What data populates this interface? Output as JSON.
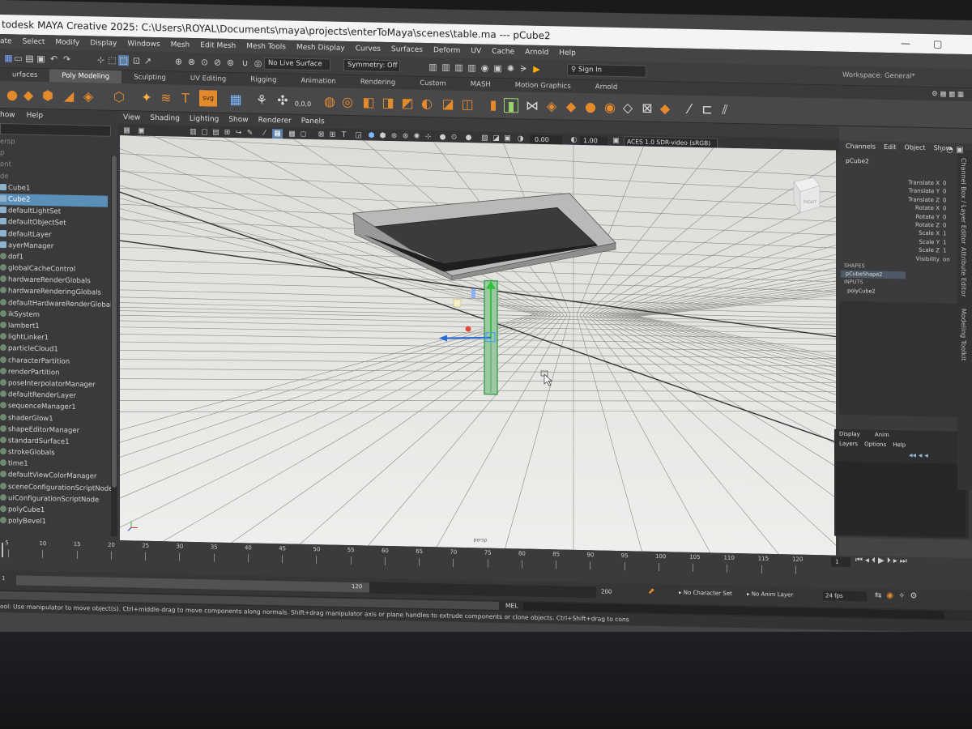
{
  "window": {
    "title": "todesk MAYA Creative 2025: C:\\Users\\ROYAL\\Documents\\maya\\projects\\enterToMaya\\scenes\\table.ma   ---   pCube2",
    "minimize": "—",
    "maximize": "▢"
  },
  "menubar": [
    "ate",
    "Select",
    "Modify",
    "Display",
    "Windows",
    "Mesh",
    "Edit Mesh",
    "Mesh Tools",
    "Mesh Display",
    "Curves",
    "Surfaces",
    "Deform",
    "UV",
    "Cache",
    "Arnold",
    "Help"
  ],
  "statusline": {
    "live_surface": "No Live Surface",
    "symmetry": "Symmetry: Off",
    "sign_in": "Sign In",
    "workspace": "Workspace: General*"
  },
  "shelf_tabs": [
    {
      "label": "urfaces",
      "active": false
    },
    {
      "label": "Poly Modeling",
      "active": true
    },
    {
      "label": "Sculpting",
      "active": false
    },
    {
      "label": "UV Editing",
      "active": false
    },
    {
      "label": "Rigging",
      "active": false
    },
    {
      "label": "Animation",
      "active": false
    },
    {
      "label": "Rendering",
      "active": false
    },
    {
      "label": "Custom",
      "active": false
    },
    {
      "label": "MASH",
      "active": false
    },
    {
      "label": "Motion Graphics",
      "active": false
    },
    {
      "label": "Arnold",
      "active": false
    }
  ],
  "shelf": {
    "svg_label": "svg",
    "coord_label": "0,0,0"
  },
  "outliner": {
    "menu": [
      "how",
      "Help"
    ],
    "items": [
      {
        "label": "ersp",
        "dim": true,
        "selected": false,
        "icon": "camera"
      },
      {
        "label": "p",
        "dim": true,
        "selected": false,
        "icon": "camera"
      },
      {
        "label": "ont",
        "dim": true,
        "selected": false,
        "icon": "camera"
      },
      {
        "label": "de",
        "dim": true,
        "selected": false,
        "icon": "camera"
      },
      {
        "label": "Cube1",
        "dim": false,
        "selected": false,
        "icon": "mesh"
      },
      {
        "label": "Cube2",
        "dim": false,
        "selected": true,
        "icon": "mesh"
      },
      {
        "label": "defaultLightSet",
        "dim": false,
        "selected": false,
        "icon": "set"
      },
      {
        "label": "defaultObjectSet",
        "dim": false,
        "selected": false,
        "icon": "set"
      },
      {
        "label": "defaultLayer",
        "dim": false,
        "selected": false,
        "icon": "layer"
      },
      {
        "label": "ayerManager",
        "dim": false,
        "selected": false,
        "icon": "layer"
      },
      {
        "label": "dof1",
        "dim": false,
        "selected": false,
        "icon": "node"
      },
      {
        "label": "globalCacheControl",
        "dim": false,
        "selected": false,
        "icon": "node"
      },
      {
        "label": "hardwareRenderGlobals",
        "dim": false,
        "selected": false,
        "icon": "node"
      },
      {
        "label": "hardwareRenderingGlobals",
        "dim": false,
        "selected": false,
        "icon": "node"
      },
      {
        "label": "defaultHardwareRenderGlobals",
        "dim": false,
        "selected": false,
        "icon": "node"
      },
      {
        "label": "ikSystem",
        "dim": false,
        "selected": false,
        "icon": "node"
      },
      {
        "label": "lambert1",
        "dim": false,
        "selected": false,
        "icon": "node"
      },
      {
        "label": "lightLinker1",
        "dim": false,
        "selected": false,
        "icon": "node"
      },
      {
        "label": "particleCloud1",
        "dim": false,
        "selected": false,
        "icon": "node"
      },
      {
        "label": "characterPartition",
        "dim": false,
        "selected": false,
        "icon": "node"
      },
      {
        "label": "renderPartition",
        "dim": false,
        "selected": false,
        "icon": "node"
      },
      {
        "label": "poseInterpolatorManager",
        "dim": false,
        "selected": false,
        "icon": "node"
      },
      {
        "label": "defaultRenderLayer",
        "dim": false,
        "selected": false,
        "icon": "node"
      },
      {
        "label": "sequenceManager1",
        "dim": false,
        "selected": false,
        "icon": "node"
      },
      {
        "label": "shaderGlow1",
        "dim": false,
        "selected": false,
        "icon": "node"
      },
      {
        "label": "shapeEditorManager",
        "dim": false,
        "selected": false,
        "icon": "node"
      },
      {
        "label": "standardSurface1",
        "dim": false,
        "selected": false,
        "icon": "node"
      },
      {
        "label": "strokeGlobals",
        "dim": false,
        "selected": false,
        "icon": "node"
      },
      {
        "label": "time1",
        "dim": false,
        "selected": false,
        "icon": "node"
      },
      {
        "label": "defaultViewColorManager",
        "dim": false,
        "selected": false,
        "icon": "node"
      },
      {
        "label": "sceneConfigurationScriptNode",
        "dim": false,
        "selected": false,
        "icon": "node"
      },
      {
        "label": "uiConfigurationScriptNode",
        "dim": false,
        "selected": false,
        "icon": "node"
      },
      {
        "label": "polyCube1",
        "dim": false,
        "selected": false,
        "icon": "node"
      },
      {
        "label": "polyBevel1",
        "dim": false,
        "selected": false,
        "icon": "node"
      }
    ]
  },
  "viewport": {
    "menu": [
      "View",
      "Shading",
      "Lighting",
      "Show",
      "Renderer",
      "Panels"
    ],
    "exposure": "0.00",
    "gamma": "1.00",
    "color_space": "ACES 1.0 SDR-video (sRGB)",
    "camera_label": "persp",
    "viewcube_label": "RIGHT"
  },
  "channel_box": {
    "menu": [
      "Channels",
      "Edit",
      "Object",
      "Show"
    ],
    "object": "pCube2",
    "attributes": [
      {
        "name": "Translate X",
        "value": "0"
      },
      {
        "name": "Translate Y",
        "value": "0"
      },
      {
        "name": "Translate Z",
        "value": "0"
      },
      {
        "name": "Rotate X",
        "value": "0"
      },
      {
        "name": "Rotate Y",
        "value": "0"
      },
      {
        "name": "Rotate Z",
        "value": "0"
      },
      {
        "name": "Scale X",
        "value": "1"
      },
      {
        "name": "Scale Y",
        "value": "1"
      },
      {
        "name": "Scale Z",
        "value": "1"
      },
      {
        "name": "Visibility",
        "value": "on"
      }
    ],
    "shapes_header": "SHAPES",
    "shape": "pCubeShape2",
    "inputs_header": "INPUTS",
    "input": "polyCube2"
  },
  "layer_editor": {
    "tabs": [
      "Display",
      "Anim"
    ],
    "menu": [
      "Layers",
      "Options",
      "Help"
    ]
  },
  "side_tabs": [
    "Channel Box / Layer Editor",
    "Attribute Editor",
    "Modeling Toolkit"
  ],
  "timeline": {
    "ticks": [
      "5",
      "10",
      "15",
      "20",
      "25",
      "30",
      "35",
      "40",
      "45",
      "50",
      "55",
      "60",
      "65",
      "70",
      "75",
      "80",
      "85",
      "90",
      "95",
      "100",
      "105",
      "110",
      "115",
      "120"
    ],
    "current_frame": "1",
    "range_start": "1",
    "range_end_inner": "120",
    "range_end_outer": "200",
    "character_set": "No Character Set",
    "anim_layer": "No Anim Layer",
    "fps": "24 fps"
  },
  "command_line": {
    "mode": "MEL"
  },
  "help_line": "ool: Use manipulator to move object(s). Ctrl+middle-drag to move components along normals. Shift+drag manipulator axis or plane handles to extrude components or clone objects. Ctrl+Shift+drag to cons"
}
